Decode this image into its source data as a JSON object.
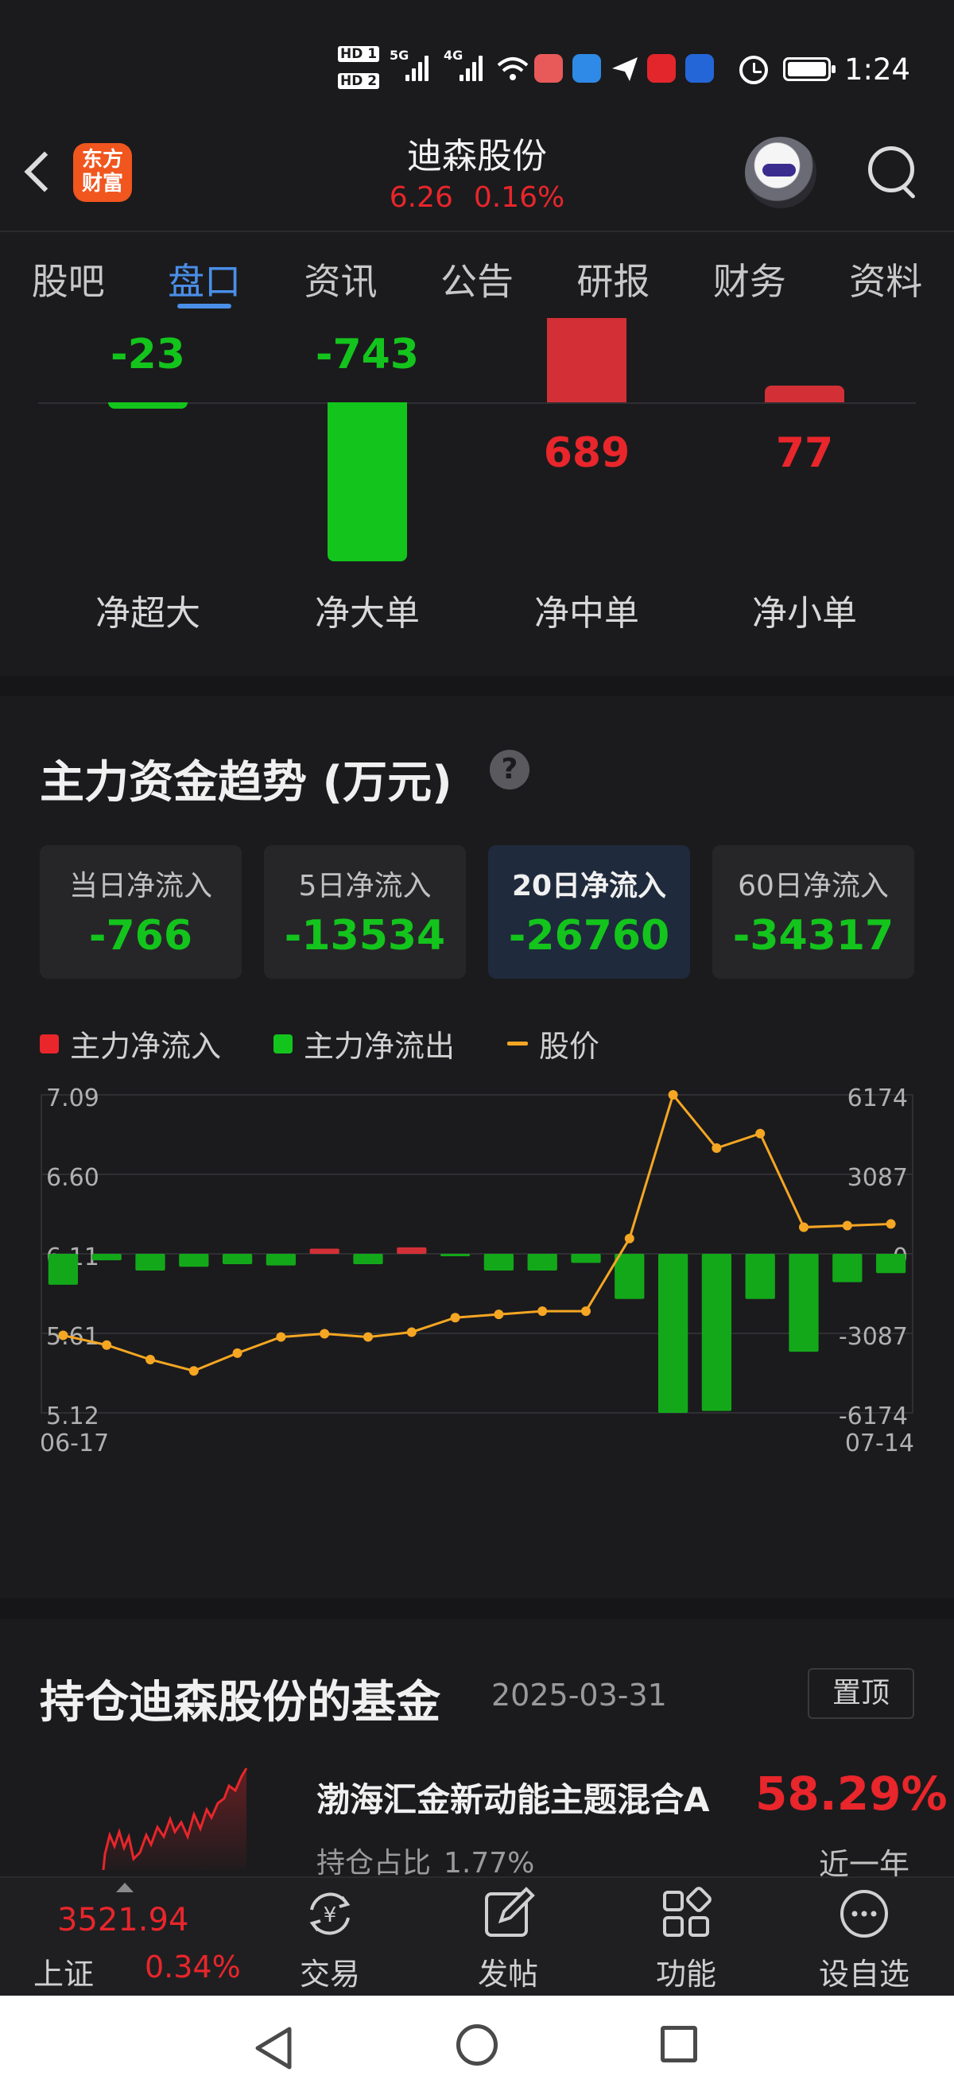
{
  "status_bar": {
    "time": "1:24",
    "hd_badges": [
      "HD 1",
      "HD 2"
    ],
    "signal_labels": [
      "5G",
      "4G"
    ]
  },
  "header": {
    "logo_line1": "东方",
    "logo_line2": "财富",
    "stock_name": "迪森股份",
    "price": "6.26",
    "change_pct": "0.16%"
  },
  "tabs": [
    {
      "label": "股吧",
      "active": false
    },
    {
      "label": "盘口",
      "active": true
    },
    {
      "label": "资讯",
      "active": false
    },
    {
      "label": "公告",
      "active": false
    },
    {
      "label": "研报",
      "active": false
    },
    {
      "label": "财务",
      "active": false
    },
    {
      "label": "资料",
      "active": false
    }
  ],
  "flow": {
    "items": [
      {
        "label": "净超大",
        "value": "-23",
        "amount": -23
      },
      {
        "label": "净大单",
        "value": "-743",
        "amount": -743
      },
      {
        "label": "净中单",
        "value": "689",
        "amount": 689
      },
      {
        "label": "净小单",
        "value": "77",
        "amount": 77
      }
    ]
  },
  "trend": {
    "title": "主力资金趋势 (万元)",
    "help": "?",
    "cards": [
      {
        "label": "当日净流入",
        "value": "-766",
        "active": false
      },
      {
        "label": "5日净流入",
        "value": "-13534",
        "active": false
      },
      {
        "label": "20日净流入",
        "value": "-26760",
        "active": true
      },
      {
        "label": "60日净流入",
        "value": "-34317",
        "active": false
      }
    ],
    "legend": [
      {
        "label": "主力净流入",
        "color": "#e8262b"
      },
      {
        "label": "主力净流出",
        "color": "#13c41c"
      },
      {
        "label": "股价",
        "color": "#f5a623"
      }
    ]
  },
  "chart_data": {
    "type": "bar",
    "x_start_label": "06-17",
    "x_end_label": "07-14",
    "left_ticks": [
      "7.09",
      "6.60",
      "6.11",
      "5.61",
      "5.12"
    ],
    "right_ticks": [
      "6174",
      "3087",
      "0",
      "-3087",
      "-6174"
    ],
    "left_range": [
      5.12,
      7.09
    ],
    "right_range": [
      -6174,
      6174
    ],
    "grid": true,
    "series": [
      {
        "name": "主力净流入/主力净流出",
        "type": "bar",
        "values": [
          -1200,
          -250,
          -650,
          -500,
          -400,
          -450,
          200,
          -400,
          250,
          -30,
          -650,
          -650,
          -350,
          -1750,
          -6174,
          -6100,
          -1750,
          -3800,
          -1100,
          -750
        ]
      },
      {
        "name": "股价",
        "type": "line",
        "values": [
          5.6,
          5.54,
          5.45,
          5.38,
          5.49,
          5.59,
          5.61,
          5.59,
          5.62,
          5.71,
          5.73,
          5.75,
          5.75,
          6.2,
          7.09,
          6.76,
          6.85,
          6.27,
          6.28,
          6.29
        ]
      }
    ]
  },
  "funds": {
    "title": "持仓迪森股份的基金",
    "date": "2025-03-31",
    "pin_label": "置顶",
    "fund_name": "渤海汇金新动能主题混合A",
    "return": "58.29%",
    "holding_label": "持仓占比",
    "holding_value": "1.77%",
    "period": "近一年"
  },
  "bottom_nav": {
    "index_value": "3521.94",
    "index_name": "上证",
    "index_change": "0.34%",
    "items": [
      {
        "label": "交易",
        "icon": "yuan-exchange-icon"
      },
      {
        "label": "发帖",
        "icon": "compose-icon"
      },
      {
        "label": "功能",
        "icon": "grid-icon"
      },
      {
        "label": "设自选",
        "icon": "more-icon"
      }
    ]
  }
}
